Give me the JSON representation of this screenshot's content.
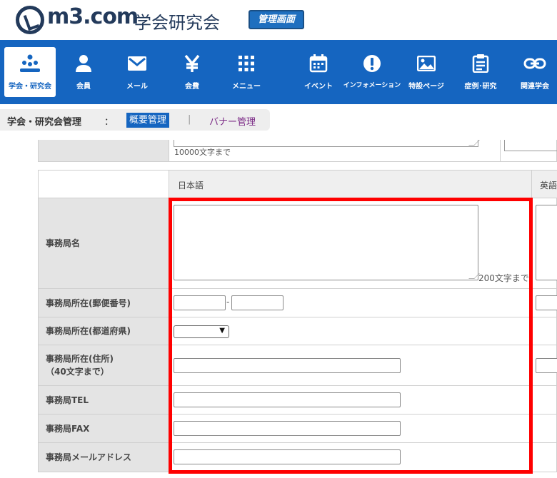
{
  "header": {
    "logo_text": "m3.com",
    "logo_sub": "学会研究会",
    "admin_badge": "管理画面"
  },
  "nav": {
    "items": [
      {
        "label": "学会・研究会",
        "icon": "people-group-icon",
        "active": true
      },
      {
        "label": "会員",
        "icon": "person-icon"
      },
      {
        "label": "メール",
        "icon": "envelope-icon"
      },
      {
        "label": "会費",
        "icon": "yen-icon"
      },
      {
        "label": "メニュー",
        "icon": "grid-menu-icon"
      },
      {
        "label": "イベント",
        "icon": "calendar-icon"
      },
      {
        "label": "インフォメーション",
        "icon": "exclamation-icon"
      },
      {
        "label": "特設ページ",
        "icon": "image-icon"
      },
      {
        "label": "症例･研究",
        "icon": "clipboard-icon"
      },
      {
        "label": "関連学会",
        "icon": "link-icon"
      }
    ]
  },
  "subnav": {
    "title": "学会・研究会管理",
    "colon": "：",
    "active_tab": "概要管理",
    "separator": "|",
    "other_tab": "バナー管理"
  },
  "upper": {
    "limit_text": "10000文字まで"
  },
  "table": {
    "col_ja": "日本語",
    "col_en": "英語",
    "rows": {
      "office_name": {
        "label": "事務局名",
        "limit": "200文字まで"
      },
      "postal": {
        "label": "事務局所在(郵便番号)",
        "dash": "-"
      },
      "prefecture": {
        "label": "事務局所在(都道府県)"
      },
      "address": {
        "label": "事務局所在(住所)",
        "label2": "（40文字まで）"
      },
      "tel": {
        "label": "事務局TEL"
      },
      "fax": {
        "label": "事務局FAX"
      },
      "email": {
        "label": "事務局メールアドレス"
      }
    }
  },
  "colors": {
    "nav_bg": "#1565c0",
    "highlight": "#ff0000",
    "label_bg": "#e4e4e4"
  }
}
